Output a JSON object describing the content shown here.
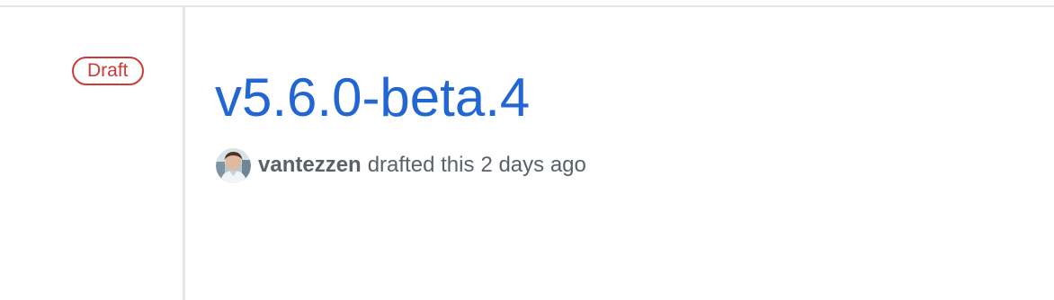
{
  "release": {
    "status_badge": "Draft",
    "title": "v5.6.0-beta.4",
    "author": "vantezzen",
    "action": "drafted this",
    "time_ago": "2 days ago"
  },
  "colors": {
    "draft_badge": "#cf3a35",
    "title_link": "#2166d3",
    "muted_text": "#5a6169",
    "timeline_line": "#e4e6e9"
  },
  "icons": {
    "author_avatar": "avatar"
  }
}
